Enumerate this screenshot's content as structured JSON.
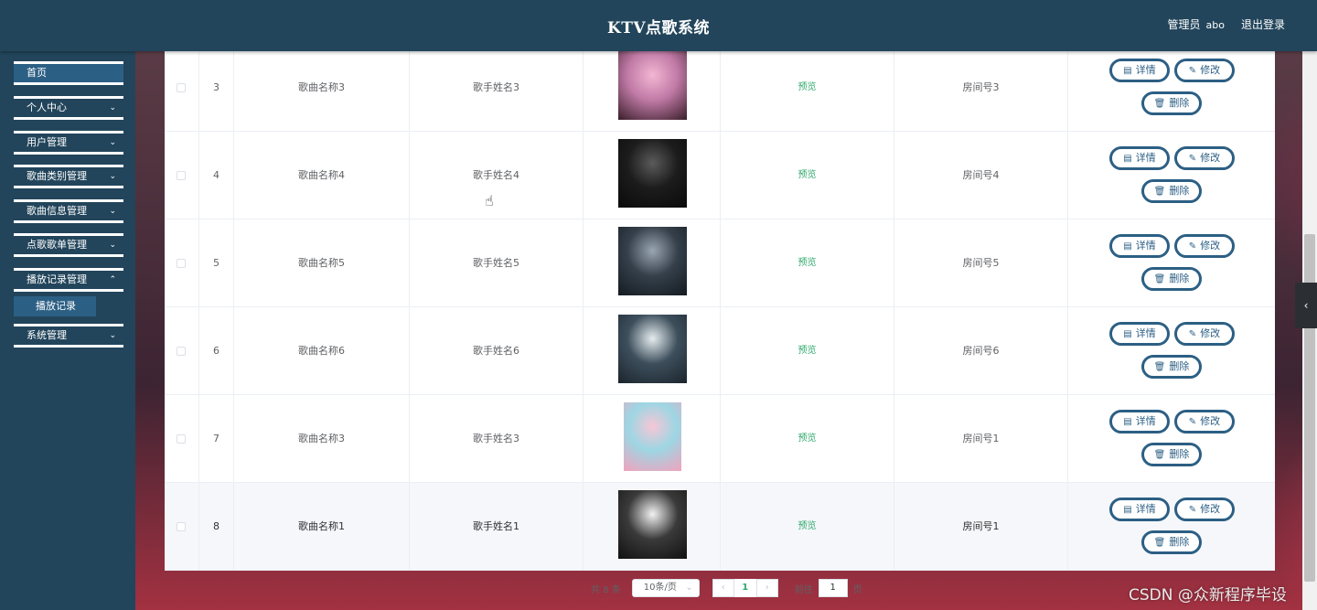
{
  "header": {
    "title": "KTV点歌系统",
    "admin_role": "管理员",
    "admin_user": "abo",
    "logout": "退出登录"
  },
  "sidebar": {
    "items": [
      {
        "label": "首页",
        "expandable": false
      },
      {
        "label": "个人中心",
        "expandable": true
      },
      {
        "label": "用户管理",
        "expandable": true
      },
      {
        "label": "歌曲类别管理",
        "expandable": true
      },
      {
        "label": "歌曲信息管理",
        "expandable": true
      },
      {
        "label": "点歌歌单管理",
        "expandable": true
      },
      {
        "label": "播放记录管理",
        "expandable": true
      },
      {
        "label": "系统管理",
        "expandable": true
      }
    ],
    "submenu": "播放记录"
  },
  "table": {
    "preview_label": "预览",
    "buttons": {
      "detail": "详情",
      "edit": "修改",
      "delete": "删除"
    },
    "rows": [
      {
        "index": "3",
        "song": "歌曲名称3",
        "singer": "歌手姓名3",
        "room": "房间号3",
        "cover_colors": [
          "#f3b6d3",
          "#c07aa6",
          "#3a1e2a"
        ]
      },
      {
        "index": "4",
        "song": "歌曲名称4",
        "singer": "歌手姓名4",
        "room": "房间号4",
        "cover_colors": [
          "#5b5b5b",
          "#1c1c1c",
          "#0a0a0a"
        ]
      },
      {
        "index": "5",
        "song": "歌曲名称5",
        "singer": "歌手姓名5",
        "room": "房间号5",
        "cover_colors": [
          "#9aa6b2",
          "#35404b",
          "#141a20"
        ]
      },
      {
        "index": "6",
        "song": "歌曲名称6",
        "singer": "歌手姓名6",
        "room": "房间号6",
        "cover_colors": [
          "#e6edf0",
          "#3d4f5c",
          "#1b242c"
        ]
      },
      {
        "index": "7",
        "song": "歌曲名称3",
        "singer": "歌手姓名3",
        "room": "房间号1",
        "cover_colors": [
          "#f7c6d6",
          "#9dd6e3",
          "#f2a2bd"
        ]
      },
      {
        "index": "8",
        "song": "歌曲名称1",
        "singer": "歌手姓名1",
        "room": "房间号1",
        "cover_colors": [
          "#f2f2f2",
          "#3a3a3a",
          "#111111"
        ]
      }
    ]
  },
  "pagination": {
    "total": "共 8 条",
    "page_size": "10条/页",
    "current": "1",
    "goto_label": "前往",
    "goto_value": "1",
    "page_suffix": "页"
  },
  "watermark": "CSDN @众新程序毕设"
}
